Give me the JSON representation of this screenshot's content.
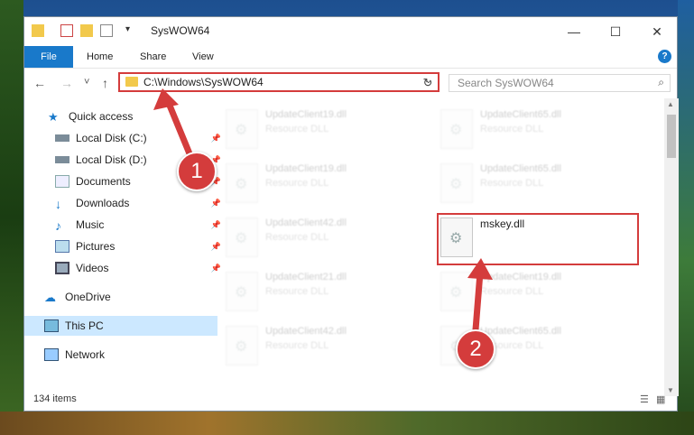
{
  "window": {
    "title": "SysWOW64",
    "controls": {
      "minimize": "—",
      "maximize": "☐",
      "close": "✕"
    }
  },
  "ribbon": {
    "file_tab": "File",
    "tabs": [
      "Home",
      "Share",
      "View"
    ],
    "help": "?"
  },
  "navigation": {
    "back": "←",
    "forward": "→",
    "recent": "˅",
    "up": "↑",
    "address": "C:\\Windows\\SysWOW64",
    "address_chevron": "⌄",
    "refresh": "↻",
    "search_placeholder": "Search SysWOW64",
    "search_icon": "⌕"
  },
  "sidebar": {
    "items": [
      {
        "label": "Quick access",
        "icon": "star-icon",
        "pinned": false
      },
      {
        "label": "Local Disk (C:)",
        "icon": "drive-icon",
        "pinned": true
      },
      {
        "label": "Local Disk (D:)",
        "icon": "drive-icon",
        "pinned": true
      },
      {
        "label": "Documents",
        "icon": "documents-icon",
        "pinned": true
      },
      {
        "label": "Downloads",
        "icon": "download-icon",
        "pinned": true
      },
      {
        "label": "Music",
        "icon": "music-icon",
        "pinned": true
      },
      {
        "label": "Pictures",
        "icon": "pictures-icon",
        "pinned": true
      },
      {
        "label": "Videos",
        "icon": "videos-icon",
        "pinned": true
      },
      {
        "label": "OneDrive",
        "icon": "cloud-icon",
        "pinned": false
      },
      {
        "label": "This PC",
        "icon": "pc-icon",
        "pinned": false,
        "selected": true
      },
      {
        "label": "Network",
        "icon": "network-icon",
        "pinned": false
      }
    ],
    "pin_glyph": "📌"
  },
  "files": {
    "left": [
      {
        "name": "UpdateClient19.dll",
        "type": "Resource DLL"
      },
      {
        "name": "UpdateClient19.dll",
        "type": "Resource DLL"
      },
      {
        "name": "UpdateClient42.dll",
        "type": "Resource DLL"
      },
      {
        "name": "UpdateClient21.dll",
        "type": "Resource DLL"
      },
      {
        "name": "UpdateClient42.dll",
        "type": "Resource DLL"
      }
    ],
    "right": [
      {
        "name": "UpdateClient65.dll",
        "type": "Resource DLL"
      },
      {
        "name": "UpdateClient65.dll",
        "type": "Resource DLL"
      },
      {
        "name": "mskey.dll",
        "type": ""
      },
      {
        "name": "UpdateClient19.dll",
        "type": "Resource DLL"
      },
      {
        "name": "UpdateClient65.dll",
        "type": "Resource DLL"
      }
    ],
    "highlighted": "mskey.dll"
  },
  "annotations": {
    "step1": "1",
    "step2": "2",
    "color": "#d43c3c"
  },
  "status": {
    "item_count": "134 items"
  },
  "colors": {
    "accent": "#1979ca",
    "highlight": "#d43c3c",
    "selection": "#cce8ff"
  }
}
